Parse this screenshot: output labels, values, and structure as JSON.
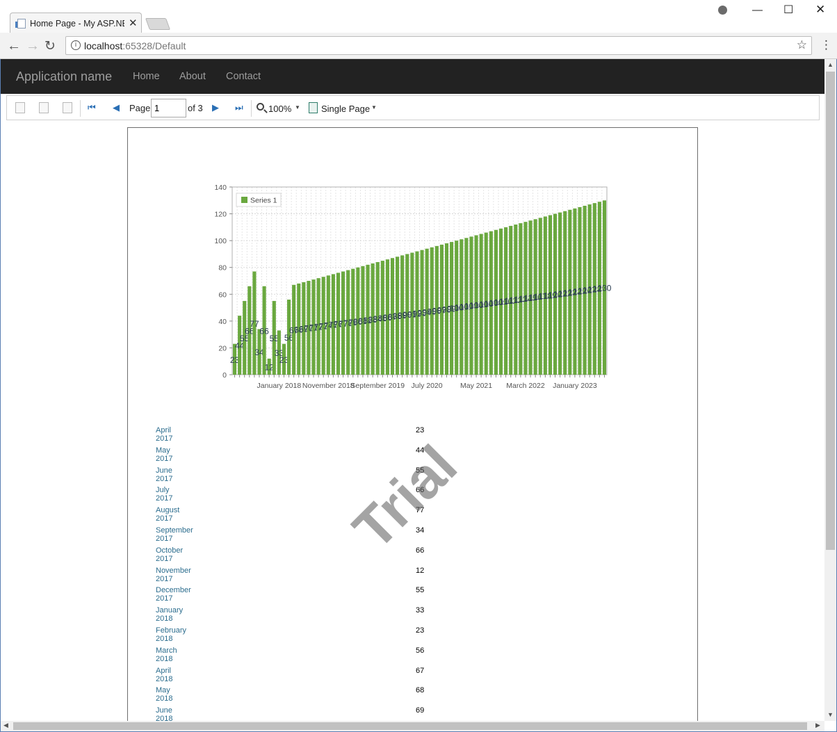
{
  "browser": {
    "tab_title": "Home Page - My ASP.NET",
    "url_host": "localhost",
    "url_rest": ":65328/Default"
  },
  "app": {
    "brand": "Application name",
    "nav": [
      "Home",
      "About",
      "Contact"
    ]
  },
  "viewer": {
    "page_label": "Page",
    "page_value": "1",
    "of_label": "of 3",
    "zoom": "100%",
    "view_mode": "Single Page"
  },
  "colors": {
    "bar": "#6aa83f",
    "navbar": "#222222",
    "link": "#2c6d8e"
  },
  "chart_data": {
    "type": "bar",
    "legend": [
      "Series 1"
    ],
    "legend_position": "top-left",
    "grid": true,
    "ylim": [
      0,
      140
    ],
    "yticks": [
      0,
      20,
      40,
      60,
      80,
      100,
      120,
      140
    ],
    "xtick_labels": [
      "January 2018",
      "November 2018",
      "September 2019",
      "July 2020",
      "May 2021",
      "March 2022",
      "January 2023"
    ],
    "xtick_indices": [
      9,
      19,
      29,
      39,
      49,
      59,
      69
    ],
    "series": [
      {
        "name": "Series 1",
        "values": [
          23,
          44,
          55,
          66,
          77,
          34,
          66,
          12,
          55,
          33,
          23,
          56,
          67,
          68,
          69,
          70,
          71,
          72,
          73,
          74,
          75,
          76,
          77,
          78,
          79,
          80,
          81,
          82,
          83,
          84,
          85,
          86,
          87,
          88,
          89,
          90,
          91,
          92,
          93,
          94,
          95,
          96,
          97,
          98,
          99,
          100,
          101,
          102,
          103,
          104,
          105,
          106,
          107,
          108,
          109,
          110,
          111,
          112,
          113,
          114,
          115,
          116,
          117,
          118,
          119,
          120,
          121,
          122,
          123,
          124,
          125,
          126,
          127,
          128,
          129,
          130
        ]
      }
    ]
  },
  "table": {
    "rows": [
      {
        "label": "April 2017",
        "value": "23"
      },
      {
        "label": "May 2017",
        "value": "44"
      },
      {
        "label": "June 2017",
        "value": "55"
      },
      {
        "label": "July 2017",
        "value": "66"
      },
      {
        "label": "August 2017",
        "value": "77"
      },
      {
        "label": "September 2017",
        "value": "34"
      },
      {
        "label": "October 2017",
        "value": "66"
      },
      {
        "label": "November 2017",
        "value": "12"
      },
      {
        "label": "December 2017",
        "value": "55"
      },
      {
        "label": "January 2018",
        "value": "33"
      },
      {
        "label": "February 2018",
        "value": "23"
      },
      {
        "label": "March 2018",
        "value": "56"
      },
      {
        "label": "April 2018",
        "value": "67"
      },
      {
        "label": "May 2018",
        "value": "68"
      },
      {
        "label": "June 2018",
        "value": "69"
      }
    ]
  },
  "watermark": "Trial"
}
